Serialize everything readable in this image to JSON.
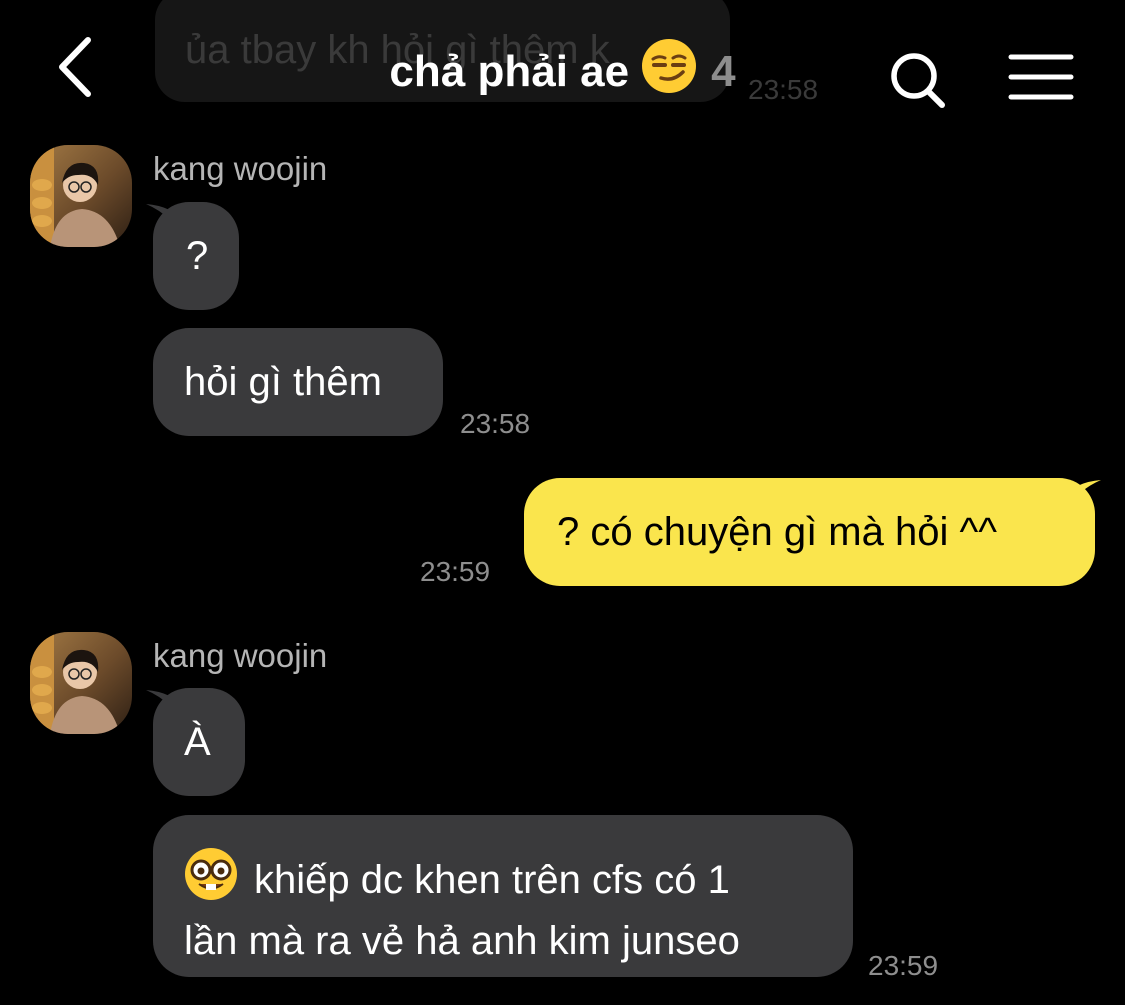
{
  "background_message": {
    "text": "ủa tbay kh hỏi gì thêm k",
    "time": "23:58"
  },
  "header": {
    "title": "chả phải ae",
    "title_emoji": "smirking-face-emoji",
    "member_count": "4",
    "icons": [
      "back-chevron-icon",
      "search-icon",
      "menu-icon"
    ]
  },
  "messages": [
    {
      "sender": "kang woojin",
      "texts": [
        "?",
        "hỏi gì thêm"
      ],
      "time": "23:58"
    },
    {
      "sender": "me",
      "text": "? có chuyện gì mà hỏi ^^",
      "time": "23:59"
    },
    {
      "sender": "kang woojin",
      "texts": [
        "À"
      ],
      "long_message": {
        "emoji": "nerd-face-emoji",
        "line1": "khiếp dc khen trên cfs có 1",
        "line2": "lần mà ra vẻ hả anh kim junseo"
      },
      "time": "23:59"
    }
  ],
  "colors": {
    "background": "#000000",
    "incoming_bubble": "#3a3a3c",
    "outgoing_bubble": "#fae54d",
    "timestamp": "#8e8e8e"
  }
}
